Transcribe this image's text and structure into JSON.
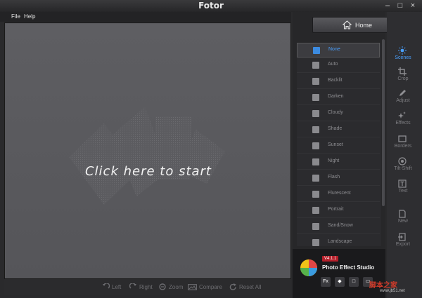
{
  "window": {
    "title": "Fotor",
    "minimize": "–",
    "maximize": "□",
    "close": "×"
  },
  "menu": {
    "items": [
      "File",
      "Help"
    ]
  },
  "canvas": {
    "prompt": "Click here to start"
  },
  "bottom_tools": [
    "Left",
    "Right",
    "Zoom",
    "Compare",
    "Reset All"
  ],
  "home_button": {
    "label": "Home",
    "icon": "home-icon"
  },
  "scenes": {
    "selected": "None",
    "items": [
      "None",
      "Auto",
      "Backlit",
      "Darken",
      "Cloudy",
      "Shade",
      "Sunset",
      "Night",
      "Flash",
      "Flurescent",
      "Portrait",
      "Sand/Snow",
      "Landscape"
    ]
  },
  "nav": {
    "active": "Scenes",
    "items": [
      {
        "label": "Scenes",
        "icon": "sun-icon"
      },
      {
        "label": "Crop",
        "icon": "crop-icon"
      },
      {
        "label": "Adjust",
        "icon": "pencil-icon"
      },
      {
        "label": "Effects",
        "icon": "sparkle-icon"
      },
      {
        "label": "Borders",
        "icon": "border-icon"
      },
      {
        "label": "Tilt-Shift",
        "icon": "target-icon"
      },
      {
        "label": "Text",
        "icon": "text-icon"
      },
      {
        "label": "New",
        "icon": "new-file-icon"
      },
      {
        "label": "Export",
        "icon": "export-icon"
      }
    ]
  },
  "promo": {
    "version": "V4.1.1",
    "name": "Photo Effect Studio",
    "badges": [
      "Fx",
      "◆",
      "□",
      "▭"
    ]
  },
  "watermark": {
    "text": "脚本之家",
    "sub": "www.jb51.net"
  },
  "colors": {
    "accent": "#4aa0ff",
    "canvas": "#58585c",
    "panel": "#272729"
  }
}
